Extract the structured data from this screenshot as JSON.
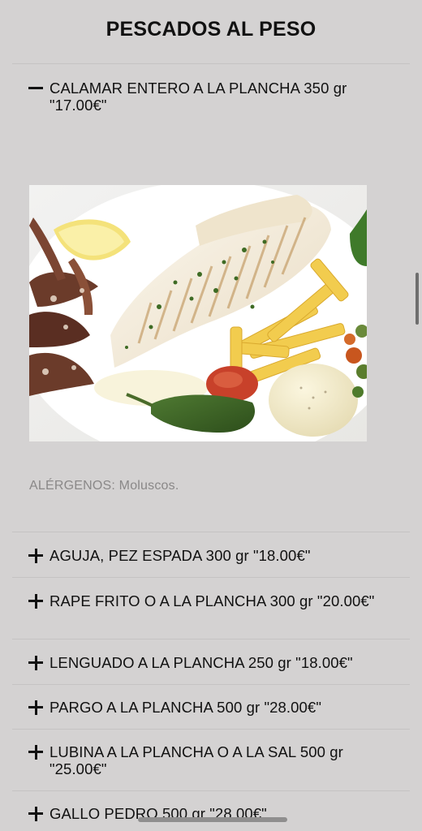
{
  "page": {
    "title": "PESCADOS AL PESO"
  },
  "items": [
    {
      "label": "CALAMAR ENTERO A LA PLANCHA 350 gr \"17.00€\"",
      "expanded": true,
      "icon": "minus-icon"
    },
    {
      "label": "AGUJA, PEZ ESPADA 300 gr \"18.00€\"",
      "expanded": false,
      "icon": "plus-icon"
    },
    {
      "label": "RAPE FRITO O A LA PLANCHA 300 gr \"20.00€\"",
      "expanded": false,
      "icon": "plus-icon"
    },
    {
      "label": "LENGUADO A LA PLANCHA 250 gr \"18.00€\"",
      "expanded": false,
      "icon": "plus-icon"
    },
    {
      "label": "PARGO A LA PLANCHA 500 gr \"28.00€\"",
      "expanded": false,
      "icon": "plus-icon"
    },
    {
      "label": "LUBINA A LA PLANCHA O A LA SAL 500 gr \"25.00€\"",
      "expanded": false,
      "icon": "plus-icon"
    },
    {
      "label": "GALLO PEDRO 500 gr \"28.00€\"",
      "expanded": false,
      "icon": "plus-icon"
    }
  ],
  "detail": {
    "allergens": "ALÉRGENOS: Moluscos."
  },
  "colors": {
    "background": "#d4d2d2",
    "text": "#111111",
    "muted_text": "#8a8888",
    "divider": "#c5c3c3"
  }
}
